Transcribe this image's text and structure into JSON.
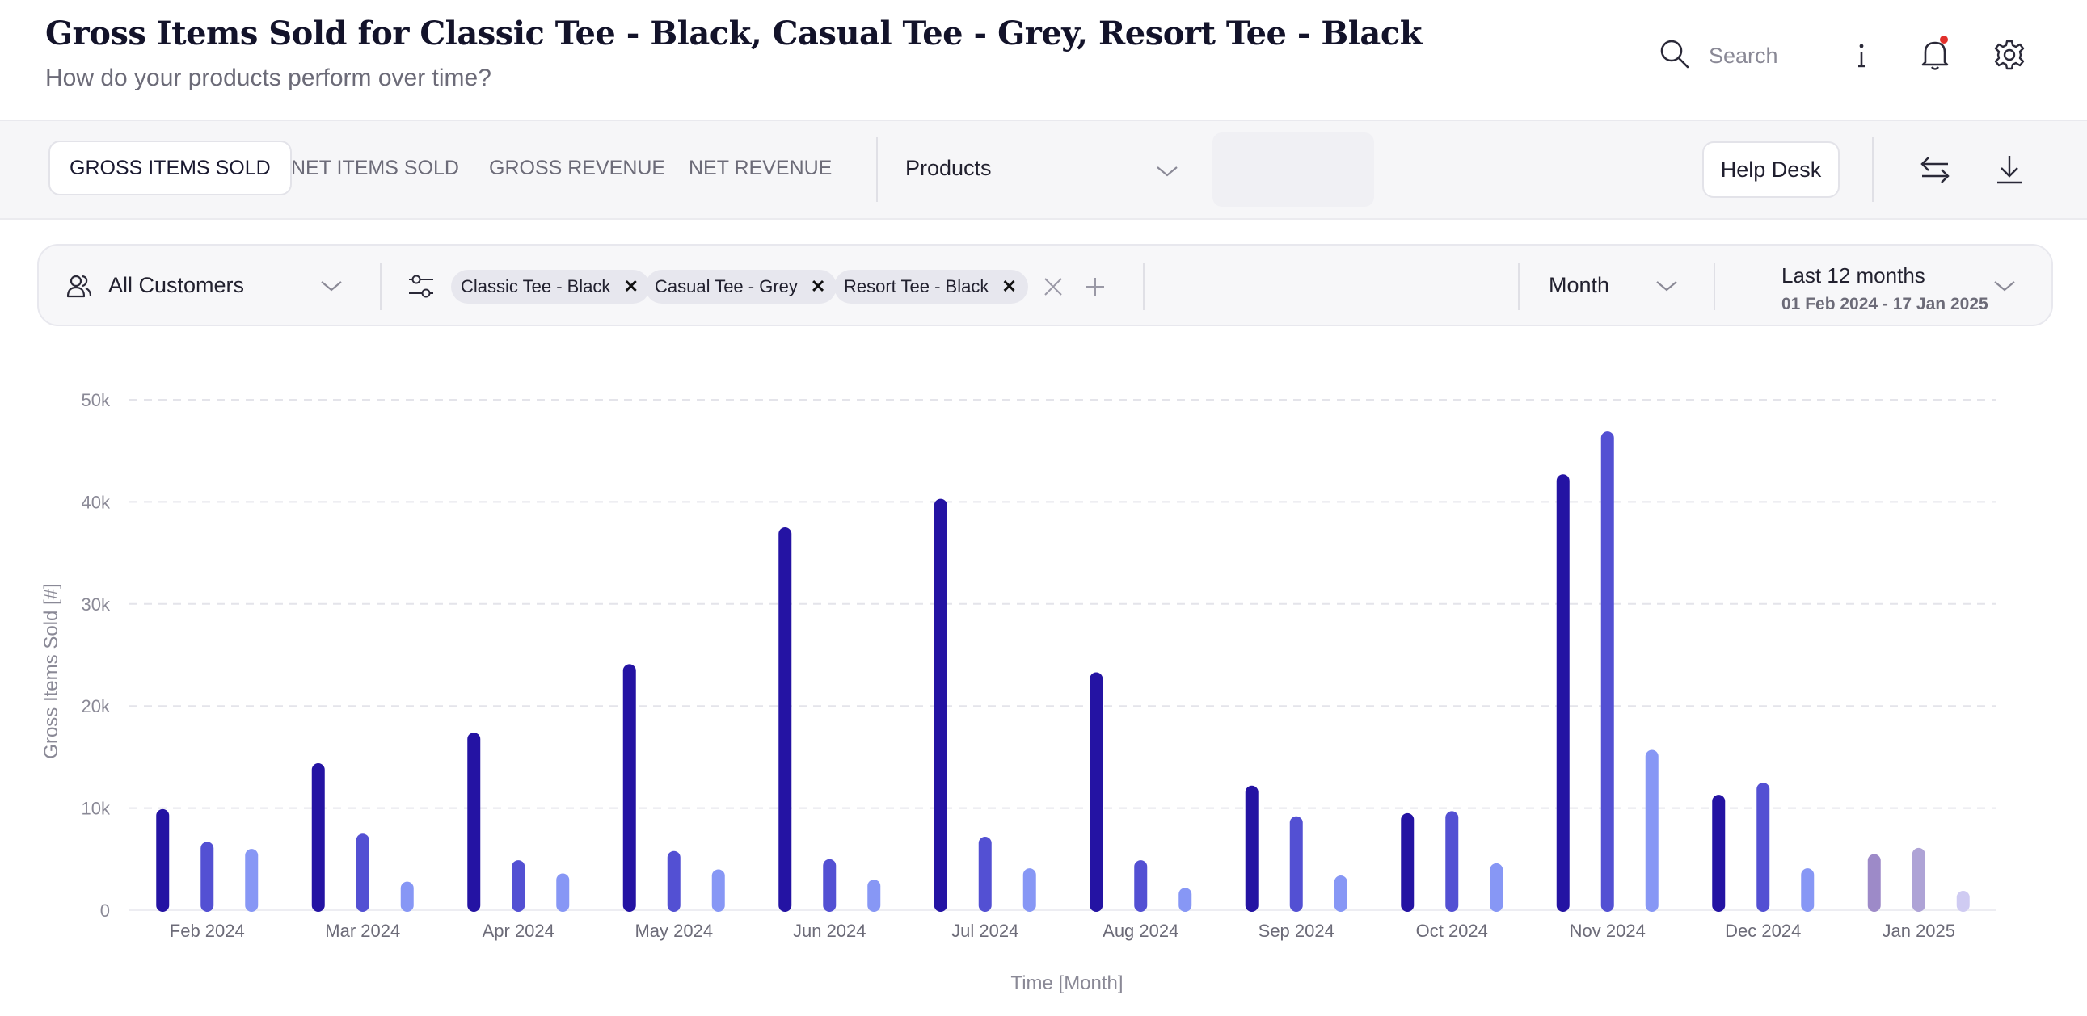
{
  "header": {
    "title": "Gross Items Sold for Classic Tee - Black, Casual Tee - Grey, Resort Tee - Black",
    "subtitle": "How do your products perform over time?",
    "search_label": "Search",
    "icons": [
      "search-icon",
      "info-icon",
      "bell-icon",
      "gear-icon"
    ]
  },
  "toolbar": {
    "tabs": [
      {
        "label": "GROSS ITEMS SOLD",
        "active": true
      },
      {
        "label": "NET ITEMS SOLD",
        "active": false
      },
      {
        "label": "GROSS REVENUE",
        "active": false
      },
      {
        "label": "NET REVENUE",
        "active": false
      }
    ],
    "dimension": "Products",
    "help_label": "Help Desk",
    "icons": [
      "swap-icon",
      "download-icon"
    ]
  },
  "filters": {
    "customer": "All Customers",
    "chips": [
      "Classic Tee - Black",
      "Casual Tee - Grey",
      "Resort Tee - Black"
    ],
    "granularity": "Month",
    "range_label": "Last 12 months",
    "range_dates": "01 Feb 2024 - 17 Jan 2025"
  },
  "chart_data": {
    "type": "bar",
    "xlabel": "Time [Month]",
    "ylabel": "Gross Items Sold [#]",
    "ylim": [
      0,
      50000
    ],
    "yticks": [
      "0",
      "10k",
      "20k",
      "30k",
      "40k",
      "50k"
    ],
    "grid": true,
    "categories": [
      "Feb 2024",
      "Mar 2024",
      "Apr 2024",
      "May 2024",
      "Jun 2024",
      "Jul 2024",
      "Aug 2024",
      "Sep 2024",
      "Oct 2024",
      "Nov 2024",
      "Dec 2024",
      "Jan 2025"
    ],
    "series": [
      {
        "color": "#2413a3",
        "values": [
          9900,
          14400,
          17400,
          24100,
          37500,
          40300,
          23300,
          12200,
          9500,
          42700,
          11300,
          5500
        ]
      },
      {
        "color": "#5350d3",
        "values": [
          6700,
          7500,
          4900,
          5800,
          5000,
          7200,
          4900,
          9200,
          9700,
          46900,
          12500,
          6100
        ]
      },
      {
        "color": "#8797f5",
        "values": [
          6000,
          2800,
          3600,
          4000,
          3000,
          4100,
          2200,
          3400,
          4600,
          15700,
          4100,
          1900
        ]
      }
    ],
    "partial_period_colors": [
      "#9d8ac8",
      "#aea3d6",
      "#cfcbf2"
    ]
  }
}
